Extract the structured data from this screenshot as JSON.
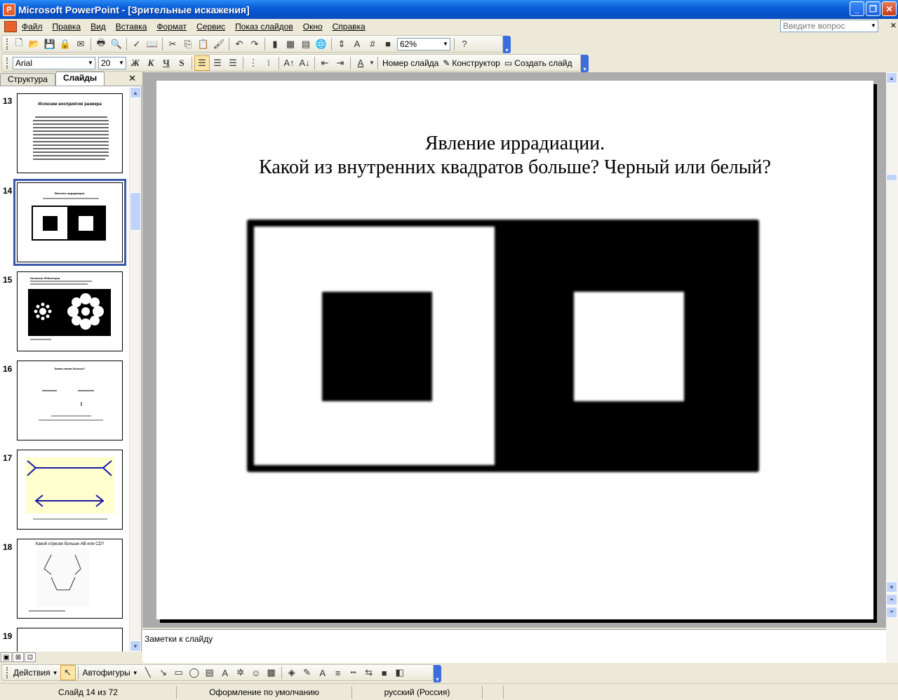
{
  "window": {
    "title": "Microsoft PowerPoint - [Зрительные искажения]"
  },
  "menu": {
    "items": [
      "Файл",
      "Правка",
      "Вид",
      "Вставка",
      "Формат",
      "Сервис",
      "Показ слайдов",
      "Окно",
      "Справка"
    ],
    "help_placeholder": "Введите вопрос"
  },
  "toolbar_standard": {
    "zoom": "62%"
  },
  "toolbar_format": {
    "font": "Arial",
    "size": "20",
    "bold": "Ж",
    "italic": "К",
    "underline": "Ч",
    "shadow": "S",
    "slide_number": "Номер слайда",
    "designer": "Конструктор",
    "new_slide": "Создать слайд"
  },
  "left_pane": {
    "tabs": [
      "Структура",
      "Слайды"
    ],
    "active_tab": "Слайды",
    "slides": [
      {
        "num": "13",
        "title": "Иллюзии восприятия размера"
      },
      {
        "num": "14",
        "title": "Явление иррадиации.",
        "selected": true
      },
      {
        "num": "15",
        "title": "Иллюзия Эббингауза"
      },
      {
        "num": "16",
        "title": "Какая линия больше?"
      },
      {
        "num": "17",
        "title": ""
      },
      {
        "num": "18",
        "title": "Какой отрезок больше AB или CD?"
      },
      {
        "num": "19",
        "title": ""
      }
    ]
  },
  "slide": {
    "title_line1": "Явление иррадиации.",
    "title_line2": "Какой из внутренних квадратов больше? Черный или белый?"
  },
  "notes": {
    "placeholder": "Заметки к слайду"
  },
  "drawing_toolbar": {
    "actions": "Действия",
    "autoshapes": "Автофигуры"
  },
  "status": {
    "slide": "Слайд 14 из 72",
    "design": "Оформление по умолчанию",
    "language": "русский (Россия)"
  },
  "colors": {
    "titlebar": "#0a5ed8",
    "selection": "#3b5aa8"
  }
}
